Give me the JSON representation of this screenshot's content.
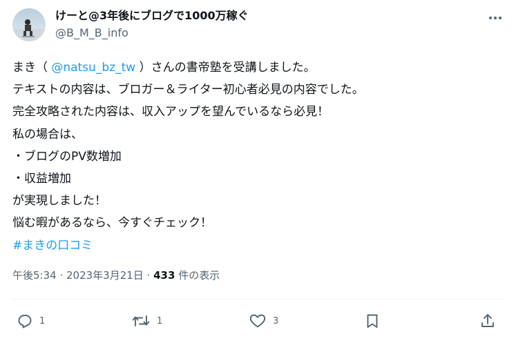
{
  "tweet": {
    "display_name": "けーと@3年後にブログで1000万稼ぐ",
    "handle": "@B_M_B_info",
    "lines": {
      "l1_pre": "まき（ ",
      "mention": "@natsu_bz_tw",
      "l1_post": " ）さんの書帝塾を受講しました。",
      "l2": "テキストの内容は、ブロガー＆ライター初心者必見の内容でした。",
      "l3": "完全攻略された内容は、収入アップを望んでいるなら必見！",
      "l4": "私の場合は、",
      "l5": "・ブログのPV数増加",
      "l6": "・収益増加",
      "l7": "が実現しました！",
      "l8": "悩む暇があるなら、今すぐチェック！"
    },
    "hashtag": "#まきの口コミ",
    "time": "午後5:34",
    "sep1": " · ",
    "date": "2023年3月21日",
    "sep2": " · ",
    "views_count": "433",
    "views_label": " 件の表示"
  },
  "actions": {
    "reply_count": "1",
    "retweet_count": "1",
    "like_count": "3"
  },
  "colors": {
    "accent": "#1d9bf0",
    "secondary_text": "#536471",
    "primary_text": "#0f1419"
  },
  "icons": {
    "reply": "reply-icon",
    "retweet": "retweet-icon",
    "like": "heart-icon",
    "bookmark": "bookmark-icon",
    "share": "share-icon",
    "more": "more-icon"
  }
}
